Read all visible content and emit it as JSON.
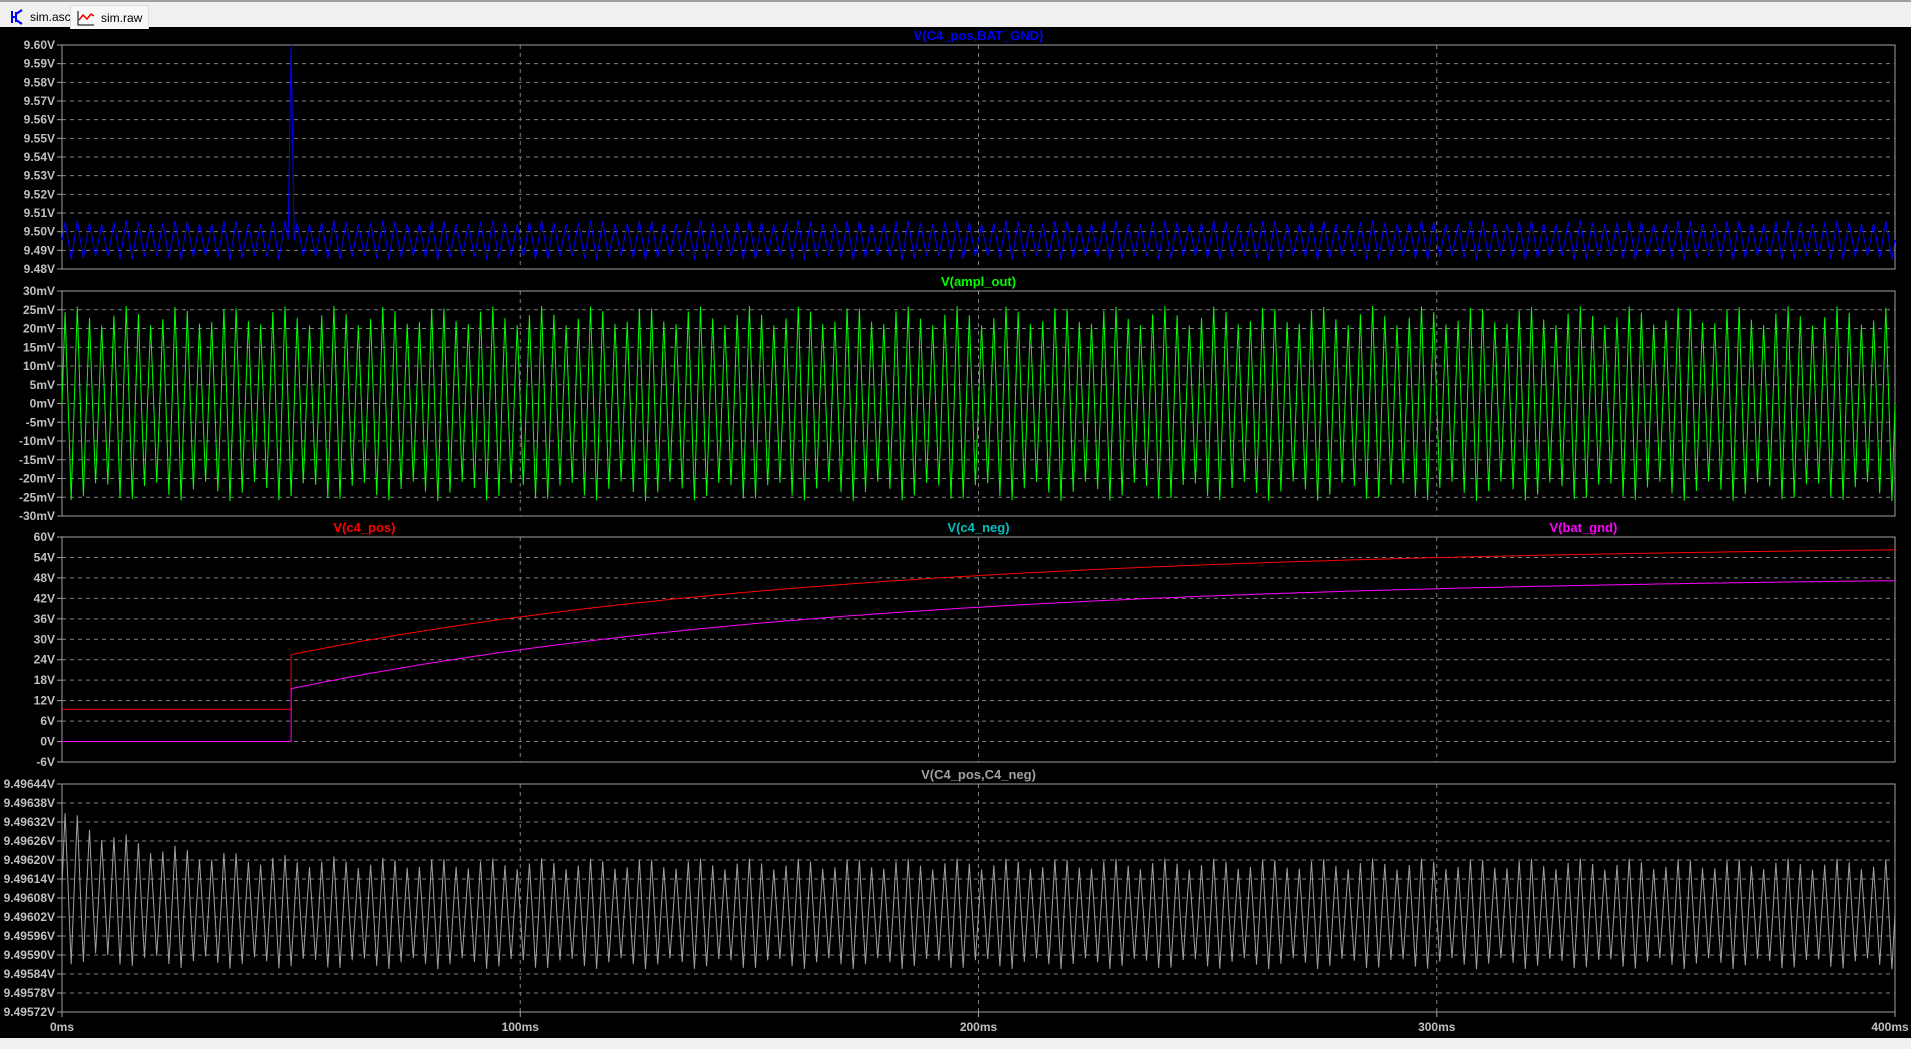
{
  "tabs": [
    {
      "label": "sim.asc",
      "icon": "transistor-icon"
    },
    {
      "label": "sim.raw",
      "icon": "waveform-icon"
    }
  ],
  "colors": {
    "grid": "#808080",
    "axis": "#a0a0a0",
    "label": "#c0c0c0"
  },
  "x_axis": {
    "min": 0,
    "max": 400,
    "unit": "ms",
    "ticks": [
      "0ms",
      "100ms",
      "200ms",
      "300ms",
      "400ms"
    ]
  },
  "chart_data": [
    {
      "type": "line",
      "title": "V(C4_pos,BAT_GND)",
      "ylim": [
        9.48,
        9.6
      ],
      "yticks": [
        "9.60V",
        "9.59V",
        "9.58V",
        "9.57V",
        "9.56V",
        "9.55V",
        "9.54V",
        "9.53V",
        "9.52V",
        "9.51V",
        "9.50V",
        "9.49V",
        "9.48V"
      ],
      "series": [
        {
          "name": "V(C4_pos,BAT_GND)",
          "color": "#0000ff",
          "kind": "osc",
          "center": 9.4955,
          "amplitude": 0.0105,
          "cycles": 150,
          "spike_at_ms": 50,
          "spike_value": 9.6
        }
      ]
    },
    {
      "type": "line",
      "title": "V(ampl_out)",
      "ylim": [
        -30,
        30
      ],
      "yticks": [
        "30mV",
        "25mV",
        "20mV",
        "15mV",
        "10mV",
        "5mV",
        "0mV",
        "-5mV",
        "-10mV",
        "-15mV",
        "-20mV",
        "-25mV",
        "-30mV"
      ],
      "series": [
        {
          "name": "V(ampl_out)",
          "color": "#00ff00",
          "kind": "osc",
          "center": 0,
          "amplitude": 26,
          "cycles": 150
        }
      ]
    },
    {
      "type": "line",
      "title": "",
      "ylim": [
        -6,
        60
      ],
      "legend": [
        {
          "name": "V(c4_pos)",
          "color": "#ff0000"
        },
        {
          "name": "V(c4_neg)",
          "color": "#00c0c0"
        },
        {
          "name": "V(bat_gnd)",
          "color": "#ff00ff"
        }
      ],
      "yticks": [
        "60V",
        "54V",
        "48V",
        "42V",
        "36V",
        "30V",
        "24V",
        "18V",
        "12V",
        "6V",
        "0V",
        "-6V"
      ],
      "series": [
        {
          "name": "V(c4_pos)",
          "color": "#ff0000",
          "kind": "charge",
          "before": 9.5,
          "step_ms": 50,
          "start": 25.5,
          "final": 58,
          "tau_ms": 120
        },
        {
          "name": "V(bat_gnd)",
          "color": "#ff00ff",
          "kind": "charge",
          "before": 0,
          "step_ms": 50,
          "start": 15.5,
          "final": 49,
          "tau_ms": 120
        }
      ]
    },
    {
      "type": "line",
      "title": "V(C4_pos,C4_neg)",
      "ylim": [
        9.49572,
        9.49644
      ],
      "yticks": [
        "9.49644V",
        "9.49638V",
        "9.49632V",
        "9.49626V",
        "9.49620V",
        "9.49614V",
        "9.49608V",
        "9.49602V",
        "9.49596V",
        "9.49590V",
        "9.49584V",
        "9.49578V",
        "9.49572V"
      ],
      "series": [
        {
          "name": "V(C4_pos,C4_neg)",
          "color": "#a0a0a0",
          "kind": "osc_settle",
          "center_start": 9.49612,
          "center": 9.49603,
          "amplitude": 0.000175,
          "amplitude_start": 0.00025,
          "cycles": 150
        }
      ]
    }
  ]
}
